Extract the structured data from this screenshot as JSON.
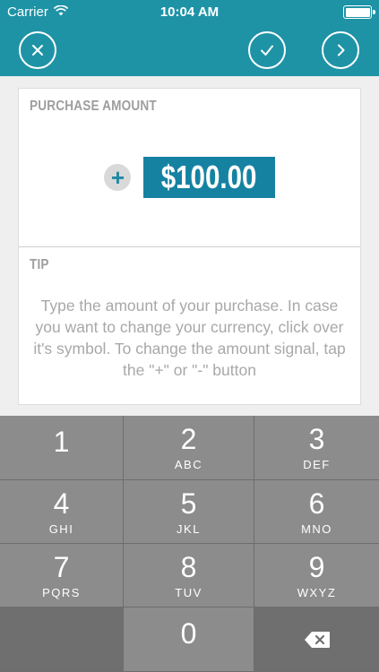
{
  "status_bar": {
    "carrier": "Carrier",
    "time": "10:04 AM",
    "wifi_icon": "wifi-icon",
    "battery_icon": "battery-icon"
  },
  "navbar": {
    "background_color": "#1e93a6",
    "buttons": [
      {
        "icon": "close-icon"
      },
      {
        "icon": "checkmark-icon"
      },
      {
        "icon": "chevron-right-icon"
      }
    ]
  },
  "purchase": {
    "section_title": "PURCHASE AMOUNT",
    "sign": "+",
    "amount": "$100.00",
    "accent_color": "#1682a2"
  },
  "tip": {
    "section_title": "TIP",
    "text": "Type the amount of your purchase.  In case you want to change your currency, click over it's symbol.  To change the amount signal, tap the \"+\" or \"-\" button"
  },
  "keypad": {
    "keys": [
      {
        "digit": "1",
        "letters": ""
      },
      {
        "digit": "2",
        "letters": "ABC"
      },
      {
        "digit": "3",
        "letters": "DEF"
      },
      {
        "digit": "4",
        "letters": "GHI"
      },
      {
        "digit": "5",
        "letters": "JKL"
      },
      {
        "digit": "6",
        "letters": "MNO"
      },
      {
        "digit": "7",
        "letters": "PQRS"
      },
      {
        "digit": "8",
        "letters": "TUV"
      },
      {
        "digit": "9",
        "letters": "WXYZ"
      },
      {
        "digit": "0",
        "letters": ""
      }
    ],
    "delete_icon": "backspace-icon"
  }
}
